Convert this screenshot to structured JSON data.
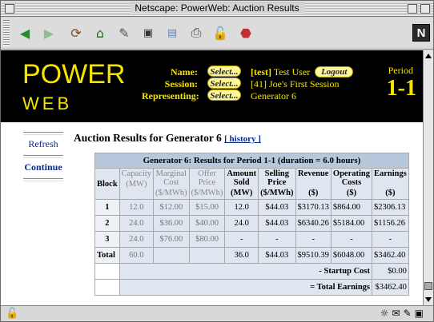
{
  "window": {
    "title": "Netscape: PowerWeb: Auction Results"
  },
  "toolbar": {
    "icons": [
      "back-icon",
      "forward-icon",
      "reload-icon",
      "home-icon",
      "search-icon",
      "netcenter-icon",
      "images-icon",
      "print-icon",
      "security-icon",
      "stop-icon"
    ],
    "netscape_logo": "N"
  },
  "banner": {
    "logo_top": "POWER",
    "logo_bottom": "WEB",
    "name_label": "Name:",
    "session_label": "Session:",
    "representing_label": "Representing:",
    "select_label": "Select...",
    "user_tag": "[test]",
    "user_name": "Test User",
    "logout_label": "Logout",
    "session_value": "[41] Joe's First Session",
    "representing_value": "Generator 6",
    "period_label": "Period",
    "period_value": "1-1"
  },
  "nav": {
    "refresh": "Refresh",
    "continue": "Continue"
  },
  "heading": {
    "text": "Auction Results for Generator 6",
    "history": "[ history ]"
  },
  "table": {
    "caption": "Generator 6: Results for Period 1-1   (duration = 6.0 hours)",
    "headers": {
      "block": "Block",
      "capacity": "Capacity",
      "capacity_unit": "(MW)",
      "marginal": "Marginal Cost",
      "marginal_unit": "($/MWh)",
      "offer": "Offer Price",
      "offer_unit": "($/MWh)",
      "amount": "Amount Sold",
      "amount_unit": "(MW)",
      "selling": "Selling Price",
      "selling_unit": "($/MWh)",
      "revenue": "Revenue",
      "revenue_unit": "($)",
      "operating": "Operating Costs",
      "operating_unit": "($)",
      "earnings": "Earnings",
      "earnings_unit": "($)"
    },
    "rows": [
      {
        "block": "1",
        "capacity": "12.0",
        "marginal": "$12.00",
        "offer": "$15.00",
        "amount": "12.0",
        "selling": "$44.03",
        "revenue": "$3170.13",
        "operating": "$864.00",
        "earnings": "$2306.13"
      },
      {
        "block": "2",
        "capacity": "24.0",
        "marginal": "$36.00",
        "offer": "$40.00",
        "amount": "24.0",
        "selling": "$44.03",
        "revenue": "$6340.26",
        "operating": "$5184.00",
        "earnings": "$1156.26"
      },
      {
        "block": "3",
        "capacity": "24.0",
        "marginal": "$76.00",
        "offer": "$80.00",
        "amount": "-",
        "selling": "-",
        "revenue": "-",
        "operating": "-",
        "earnings": "-"
      }
    ],
    "total": {
      "label": "Total",
      "capacity": "60.0",
      "amount": "36.0",
      "selling": "$44.03",
      "revenue": "$9510.39",
      "operating": "$6048.00",
      "earnings": "$3462.40"
    },
    "startup": {
      "label": "- Startup Cost",
      "value": "$0.00"
    },
    "total_earnings": {
      "label": "= Total Earnings",
      "value": "$3462.40"
    }
  }
}
